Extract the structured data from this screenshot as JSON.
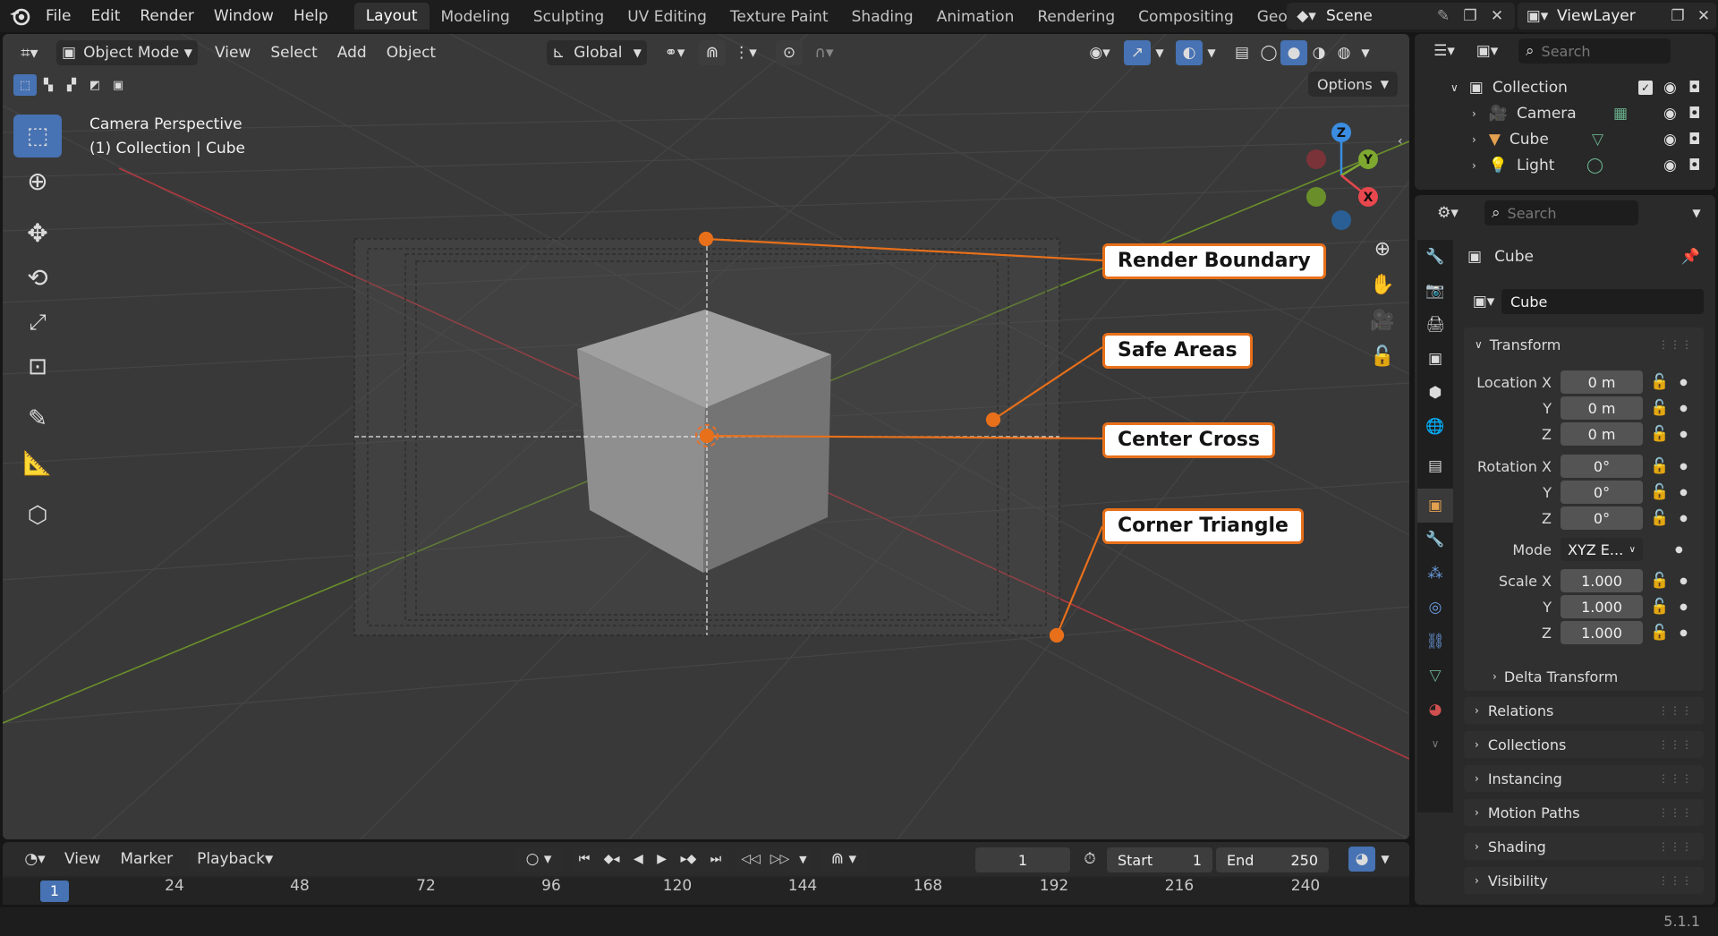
{
  "menubar": {
    "menus": [
      "File",
      "Edit",
      "Render",
      "Window",
      "Help"
    ],
    "workspaces": [
      "Layout",
      "Modeling",
      "Sculpting",
      "UV Editing",
      "Texture Paint",
      "Shading",
      "Animation",
      "Rendering",
      "Compositing",
      "Geometr"
    ],
    "active_workspace": "Layout",
    "scene_name": "Scene",
    "view_layer": "ViewLayer"
  },
  "viewport_header": {
    "mode": "Object Mode",
    "menus": [
      "View",
      "Select",
      "Add",
      "Object"
    ],
    "transform_orientation": "Global",
    "options_label": "Options"
  },
  "viewport": {
    "camera_label": "Camera Perspective",
    "context_label": "(1) Collection | Cube"
  },
  "gizmo": {
    "x": "X",
    "y": "Y",
    "z": "Z"
  },
  "callouts": [
    "Render Boundary",
    "Safe Areas",
    "Center Cross",
    "Corner Triangle"
  ],
  "colors": {
    "accent": "#e8701a",
    "active_tool": "#4772b3",
    "x_axis": "#e8474e",
    "y_axis": "#7ea82f",
    "z_axis": "#3b8de1"
  },
  "outliner": {
    "search_placeholder": "Search",
    "collection": "Collection",
    "items": [
      "Camera",
      "Cube",
      "Light"
    ]
  },
  "properties": {
    "search_placeholder": "Search",
    "object_name": "Cube",
    "datablock_name": "Cube",
    "transform_title": "Transform",
    "location": {
      "label": "Location X",
      "x": "0 m",
      "y": "0 m",
      "z": "0 m"
    },
    "rotation": {
      "label": "Rotation X",
      "x": "0°",
      "y": "0°",
      "z": "0°"
    },
    "mode_label": "Mode",
    "mode_value": "XYZ E...",
    "scale": {
      "label": "Scale X",
      "x": "1.000",
      "y": "1.000",
      "z": "1.000"
    },
    "axis_y": "Y",
    "axis_z": "Z",
    "delta_transform": "Delta Transform",
    "panels": [
      "Relations",
      "Collections",
      "Instancing",
      "Motion Paths",
      "Shading",
      "Visibility"
    ]
  },
  "timeline": {
    "menus": [
      "View",
      "Marker"
    ],
    "playback": "Playback",
    "current_frame": "1",
    "start_label": "Start",
    "start_value": "1",
    "end_label": "End",
    "end_value": "250",
    "ruler": [
      "1",
      "24",
      "48",
      "72",
      "96",
      "120",
      "144",
      "168",
      "192",
      "216",
      "240"
    ]
  },
  "status": {
    "version": "5.1.1"
  }
}
